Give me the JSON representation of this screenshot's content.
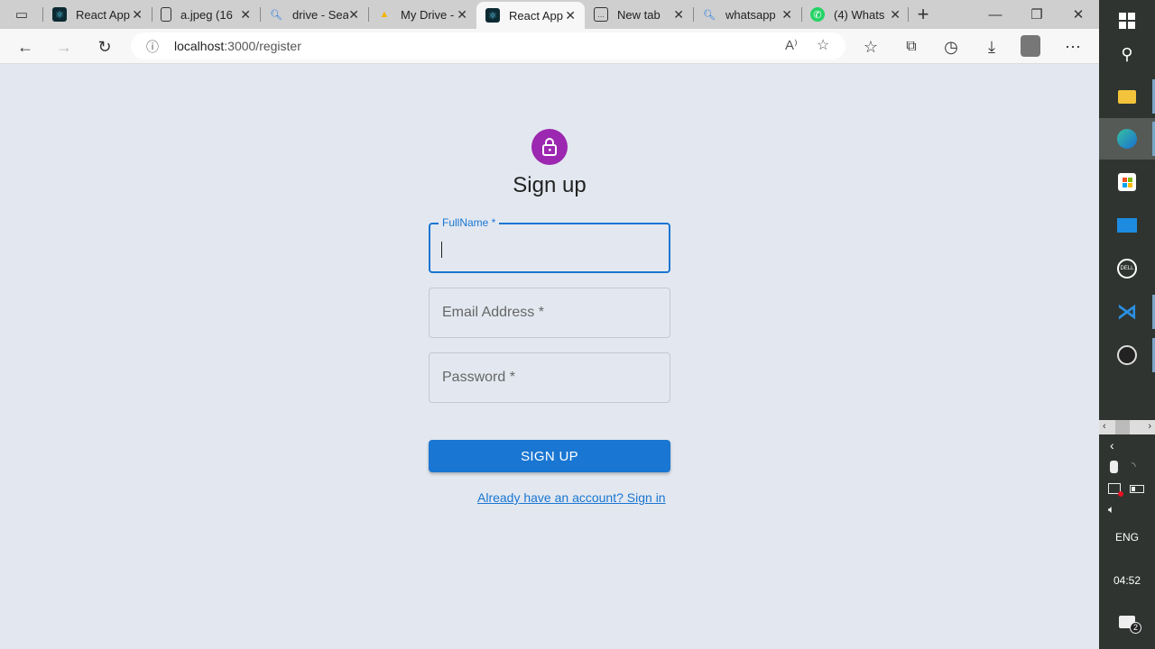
{
  "browser": {
    "tabs": [
      {
        "label": "React App",
        "icon": "react-icon",
        "active": false
      },
      {
        "label": "a.jpeg (16",
        "icon": "file-icon",
        "active": false
      },
      {
        "label": "drive - Sea",
        "icon": "search-icon",
        "active": false
      },
      {
        "label": "My Drive -",
        "icon": "google-drive-icon",
        "active": false
      },
      {
        "label": "React App",
        "icon": "react-icon",
        "active": true
      },
      {
        "label": "New tab",
        "icon": "new-tab-icon",
        "active": false
      },
      {
        "label": "whatsapp",
        "icon": "search-icon",
        "active": false
      },
      {
        "label": "(4) Whats",
        "icon": "whatsapp-icon",
        "active": false
      }
    ],
    "url_host": "localhost",
    "url_path": ":3000/register"
  },
  "form": {
    "title": "Sign up",
    "fullname_label": "FullName *",
    "email_placeholder": "Email Address *",
    "password_placeholder": "Password *",
    "submit_label": "SIGN UP",
    "signin_link": "Already have an account? Sign in"
  },
  "taskbar": {
    "language": "ENG",
    "time": "04:52",
    "notifications": "2"
  },
  "colors": {
    "primary": "#1976d2",
    "avatar": "#9c27b0",
    "background": "#e3e8f0"
  }
}
